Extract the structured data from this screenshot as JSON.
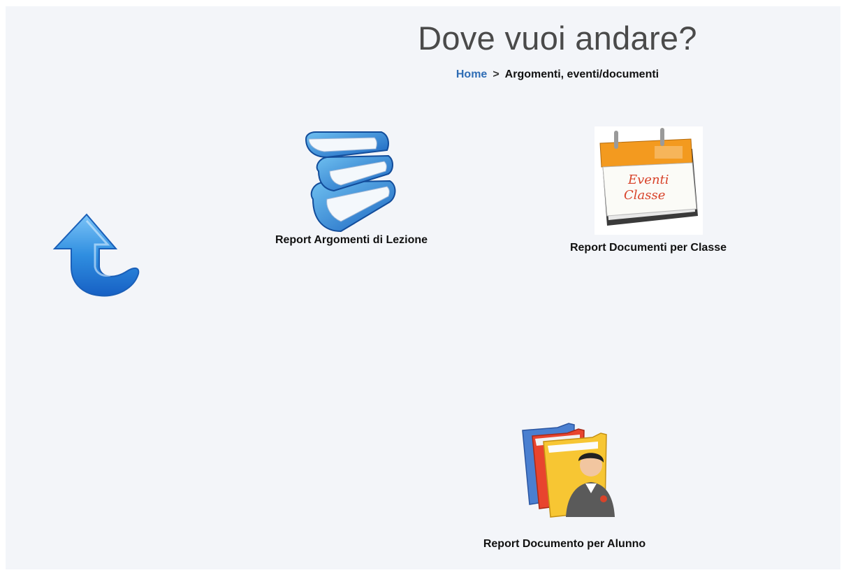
{
  "header": {
    "title": "Dove vuoi andare?"
  },
  "breadcrumb": {
    "home": "Home",
    "separator": ">",
    "current": "Argomenti, eventi/documenti"
  },
  "back": {
    "icon": "back-arrow-icon"
  },
  "tiles": [
    {
      "label": "Report Argomenti di Lezione",
      "icon": "books-icon"
    },
    {
      "label": "Report Documenti per Classe",
      "icon": "calendar-icon",
      "icon_text_1": "Eventi",
      "icon_text_2": "Classe"
    },
    {
      "label": "Report Documento per Alunno",
      "icon": "student-folders-icon"
    }
  ],
  "colors": {
    "background": "#f3f5f9",
    "link": "#2f6db5",
    "accent_blue": "#2a7fd4",
    "calendar_orange": "#f39a1f"
  }
}
